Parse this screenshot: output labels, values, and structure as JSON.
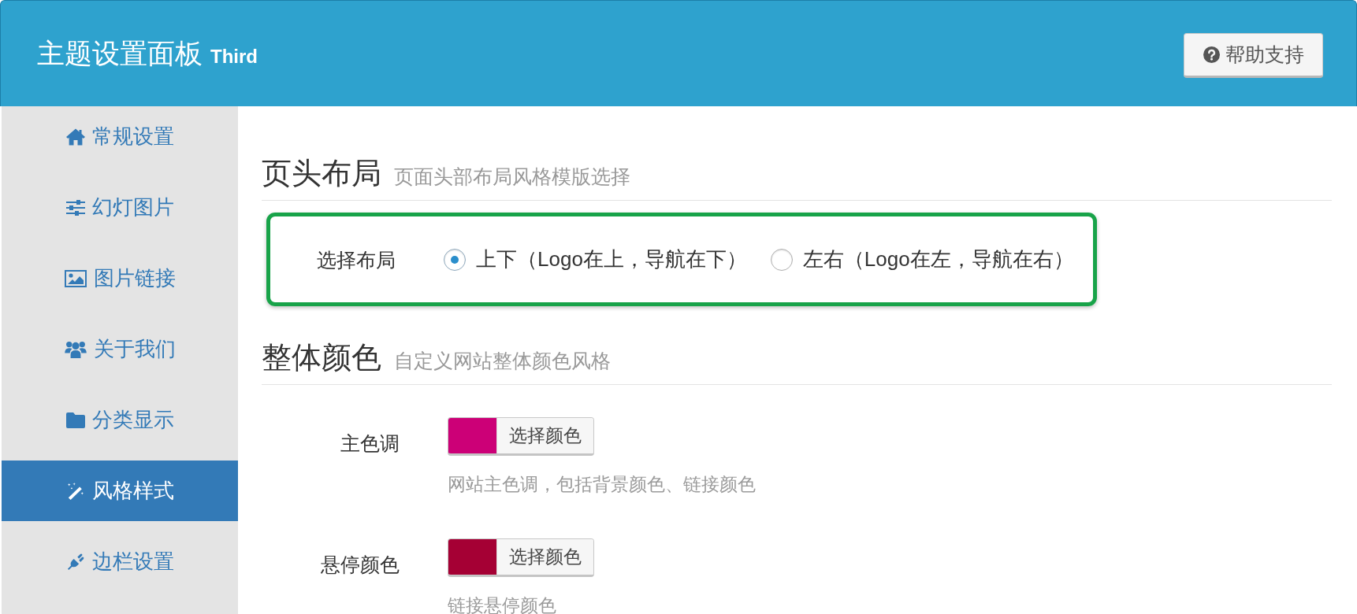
{
  "header": {
    "title": "主题设置面板",
    "edition": "Third",
    "help_button": "帮助支持"
  },
  "sidebar": {
    "items": [
      {
        "label": "常规设置",
        "selected": false
      },
      {
        "label": "幻灯图片",
        "selected": false
      },
      {
        "label": "图片链接",
        "selected": false
      },
      {
        "label": "关于我们",
        "selected": false
      },
      {
        "label": "分类显示",
        "selected": false
      },
      {
        "label": "风格样式",
        "selected": true
      },
      {
        "label": "边栏设置",
        "selected": false
      }
    ]
  },
  "sections": [
    {
      "title": "页头布局",
      "subtitle": "页面头部布局风格模版选择",
      "fields": [
        {
          "kind": "radio",
          "label": "选择布局",
          "highlighted": true,
          "options": [
            {
              "label": "上下（Logo在上，导航在下）",
              "selected": true
            },
            {
              "label": "左右（Logo在左，导航在右）",
              "selected": false
            }
          ]
        }
      ]
    },
    {
      "title": "整体颜色",
      "subtitle": "自定义网站整体颜色风格",
      "fields": [
        {
          "kind": "color",
          "label": "主色调",
          "color": "#cc0077",
          "button": "选择颜色",
          "help": "网站主色调，包括背景颜色、链接颜色"
        },
        {
          "kind": "color",
          "label": "悬停颜色",
          "color": "#a50034",
          "button": "选择颜色",
          "help": "链接悬停颜色"
        }
      ]
    }
  ]
}
